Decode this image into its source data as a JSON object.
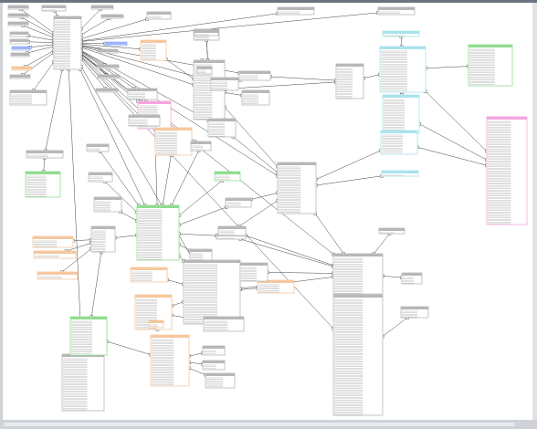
{
  "palette": {
    "gray": "#b7b7b7",
    "orange": "#f6c79e",
    "green": "#8fdc8f",
    "cyan": "#a9e3ec",
    "pink": "#f3a6e0",
    "blue": "#9fb3f5",
    "line": "#444444",
    "rowline": "#dddddd"
  },
  "table_text_note": "",
  "tables": [
    {
      "id": "t1",
      "color": "gray"
    },
    {
      "id": "t2",
      "color": "gray"
    },
    {
      "id": "t3",
      "color": "gray"
    },
    {
      "id": "t4",
      "color": "gray"
    },
    {
      "id": "t5",
      "color": "gray"
    },
    {
      "id": "t6",
      "color": "blue"
    },
    {
      "id": "t7",
      "color": "gray"
    },
    {
      "id": "t8",
      "color": "orange"
    },
    {
      "id": "t9",
      "color": "gray"
    },
    {
      "id": "t10",
      "color": "gray"
    },
    {
      "id": "t11",
      "color": "gray"
    },
    {
      "id": "t12",
      "color": "gray"
    },
    {
      "id": "t13",
      "color": "gray"
    },
    {
      "id": "t14",
      "color": "gray"
    },
    {
      "id": "t15",
      "color": "blue"
    },
    {
      "id": "t16",
      "color": "orange"
    },
    {
      "id": "t17",
      "color": "gray"
    },
    {
      "id": "t18",
      "color": "gray"
    },
    {
      "id": "t19",
      "color": "gray"
    },
    {
      "id": "t20",
      "color": "gray"
    },
    {
      "id": "t21",
      "color": "gray"
    },
    {
      "id": "t22",
      "color": "gray"
    },
    {
      "id": "t23",
      "color": "gray"
    },
    {
      "id": "t24",
      "color": "gray"
    },
    {
      "id": "t25",
      "color": "pink"
    },
    {
      "id": "t26",
      "color": "gray"
    },
    {
      "id": "t27",
      "color": "orange"
    },
    {
      "id": "t28",
      "color": "gray"
    },
    {
      "id": "t29",
      "color": "gray"
    },
    {
      "id": "t30",
      "color": "gray"
    },
    {
      "id": "t31",
      "color": "gray"
    },
    {
      "id": "t32",
      "color": "green"
    },
    {
      "id": "t33",
      "color": "gray"
    },
    {
      "id": "t34",
      "color": "gray"
    },
    {
      "id": "t35",
      "color": "gray"
    },
    {
      "id": "t36",
      "color": "gray"
    },
    {
      "id": "t37",
      "color": "cyan"
    },
    {
      "id": "t38",
      "color": "cyan"
    },
    {
      "id": "t39",
      "color": "cyan"
    },
    {
      "id": "t40",
      "color": "green"
    },
    {
      "id": "t41",
      "color": "gray"
    },
    {
      "id": "t42",
      "color": "gray"
    },
    {
      "id": "t43",
      "color": "cyan"
    },
    {
      "id": "t44",
      "color": "cyan"
    },
    {
      "id": "t45",
      "color": "pink"
    },
    {
      "id": "t46",
      "color": "gray"
    },
    {
      "id": "t47",
      "color": "gray"
    },
    {
      "id": "t48",
      "color": "green"
    },
    {
      "id": "t49",
      "color": "gray"
    },
    {
      "id": "t50",
      "color": "orange"
    },
    {
      "id": "t51",
      "color": "gray"
    },
    {
      "id": "t52",
      "color": "green"
    },
    {
      "id": "t53",
      "color": "gray"
    },
    {
      "id": "t54",
      "color": "gray"
    },
    {
      "id": "t55",
      "color": "orange"
    },
    {
      "id": "t56",
      "color": "orange"
    },
    {
      "id": "t57",
      "color": "gray"
    },
    {
      "id": "t58",
      "color": "orange"
    },
    {
      "id": "t59",
      "color": "gray"
    },
    {
      "id": "t60",
      "color": "orange"
    },
    {
      "id": "t61",
      "color": "gray"
    },
    {
      "id": "t62",
      "color": "orange"
    },
    {
      "id": "t63",
      "color": "orange"
    },
    {
      "id": "t64",
      "color": "gray"
    },
    {
      "id": "t65",
      "color": "orange"
    },
    {
      "id": "t66",
      "color": "gray"
    },
    {
      "id": "t67",
      "color": "gray"
    },
    {
      "id": "t68",
      "color": "gray"
    },
    {
      "id": "t69",
      "color": "gray"
    },
    {
      "id": "t70",
      "color": "gray"
    },
    {
      "id": "t71",
      "color": "gray"
    },
    {
      "id": "t72",
      "color": "gray"
    },
    {
      "id": "t73",
      "color": "gray"
    },
    {
      "id": "t74",
      "color": "green"
    },
    {
      "id": "t75",
      "color": "gray"
    },
    {
      "id": "t76",
      "color": "gray"
    },
    {
      "id": "t77",
      "color": "gray"
    },
    {
      "id": "t78",
      "color": "gray"
    }
  ]
}
